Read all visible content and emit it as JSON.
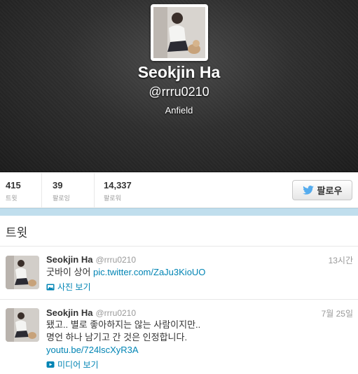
{
  "profile": {
    "name": "Seokjin Ha",
    "handle": "@rrru0210",
    "location": "Anfield"
  },
  "stats": [
    {
      "value": "415",
      "label": "트윗"
    },
    {
      "value": "39",
      "label": "팔로잉"
    },
    {
      "value": "14,337",
      "label": "팔로워"
    }
  ],
  "follow_button": {
    "label": "팔로우",
    "icon": "twitter-bird-icon"
  },
  "section": {
    "title": "트윗"
  },
  "tweets": [
    {
      "name": "Seokjin Ha",
      "handle": "@rrru0210",
      "time": "13시간",
      "text": "굿바이 상어 ",
      "link": "pic.twitter.com/ZaJu3KioUO",
      "media_label": "사진 보기",
      "media_icon": "photo-icon"
    },
    {
      "name": "Seokjin Ha",
      "handle": "@rrru0210",
      "time": "7월 25일",
      "text_line1": "됐고.. 별로 좋아하지는 않는 사람이지만..",
      "text_line2": "명언 하나 남기고 간 것은 인정합니다.",
      "link": "youtu.be/724lscXyR3A",
      "media_label": "미디어 보기",
      "media_icon": "play-icon"
    }
  ],
  "colors": {
    "link": "#0084b4",
    "band": "#c0deed",
    "twitter_blue": "#55acee"
  }
}
